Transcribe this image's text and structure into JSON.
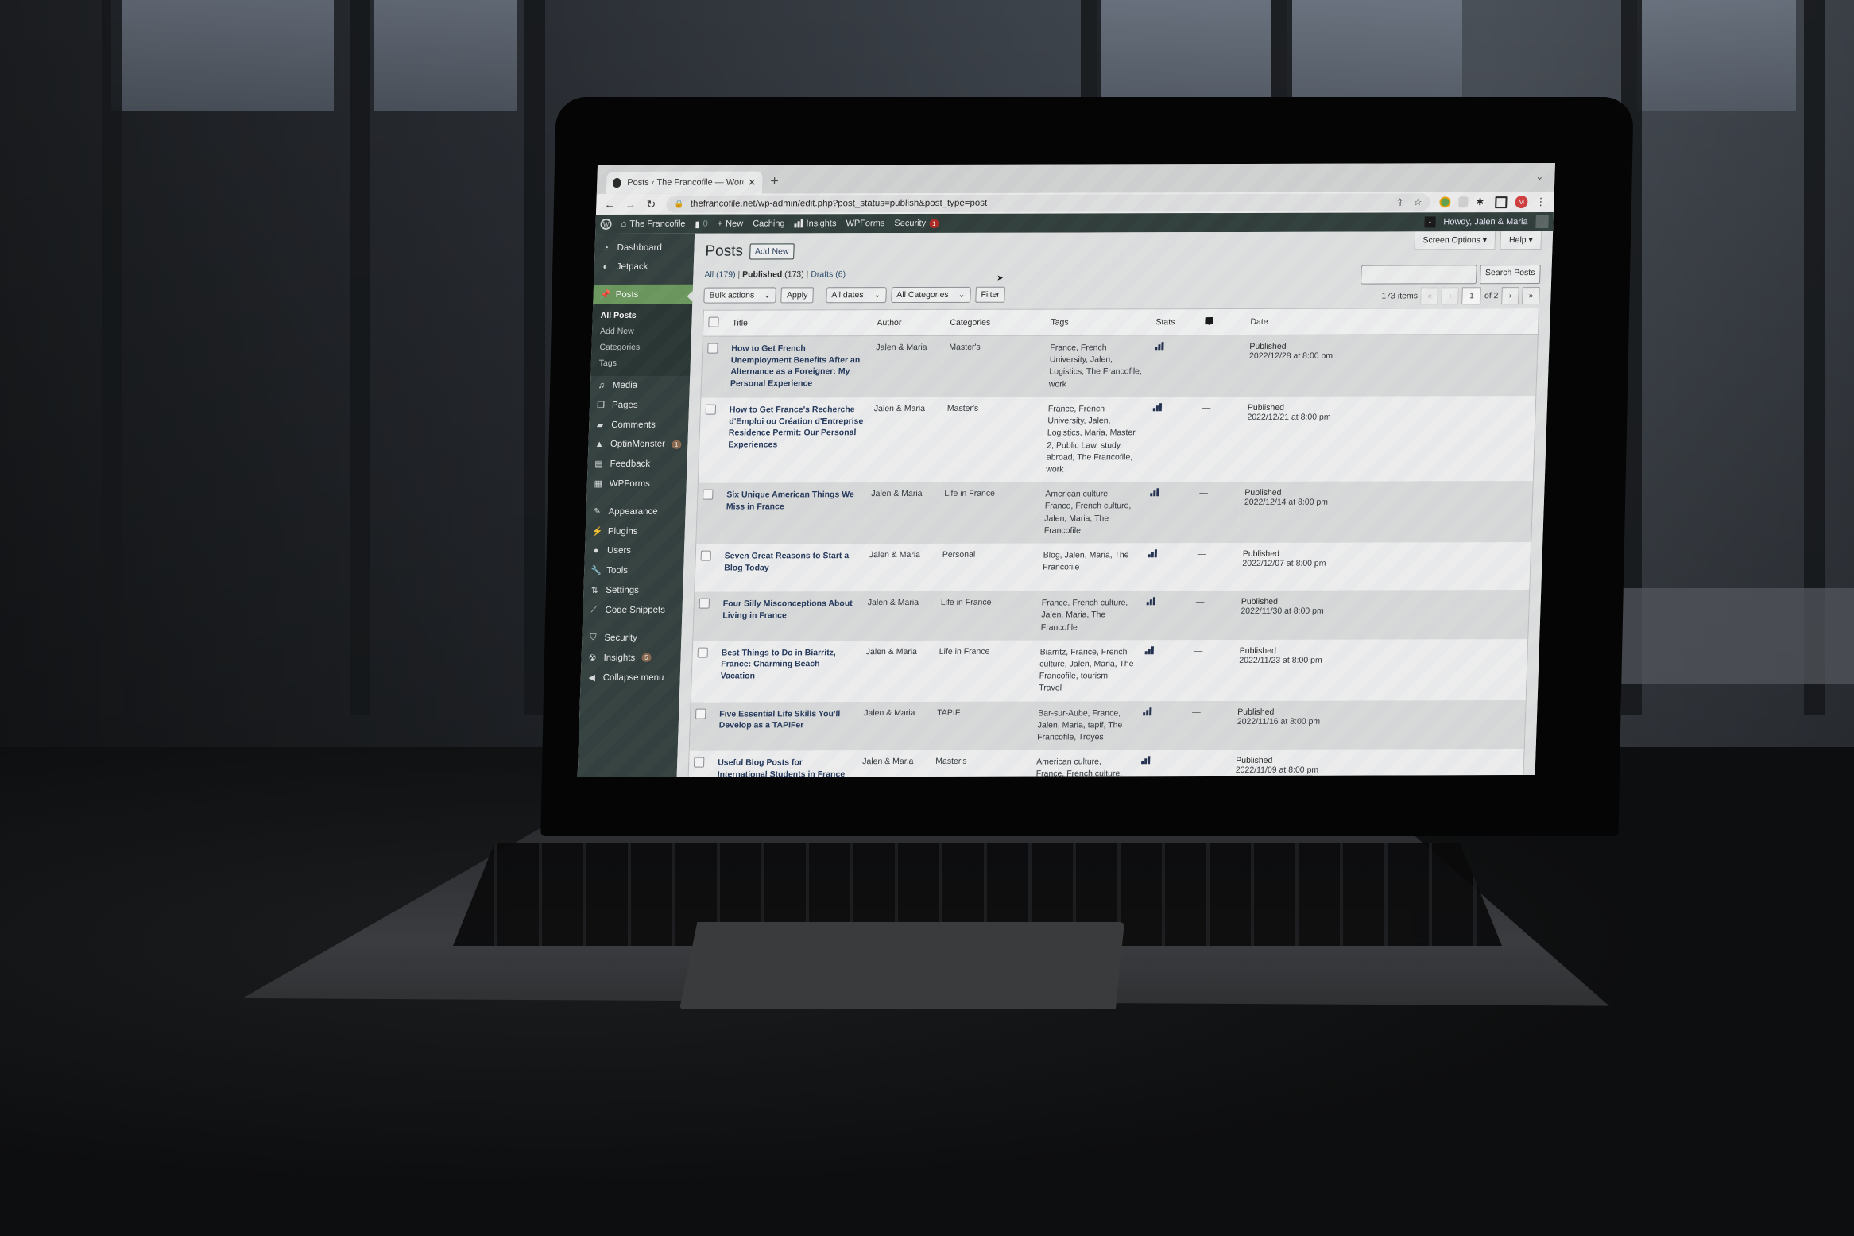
{
  "browser": {
    "tab_title": "Posts ‹ The Francofile — WordPress",
    "url": "thefrancofile.net/wp-admin/edit.php?post_status=publish&post_type=post",
    "profile_initial": "M"
  },
  "admin_bar": {
    "site_name": "The Francofile",
    "comments_count": "0",
    "new_label": "New",
    "caching_label": "Caching",
    "insights_label": "Insights",
    "wpforms_label": "WPForms",
    "security_label": "Security",
    "security_badge": "1",
    "greeting": "Howdy, Jalen & Maria"
  },
  "sidebar": {
    "items": [
      {
        "label": "Dashboard",
        "icon": "dashboard-icon"
      },
      {
        "label": "Jetpack",
        "icon": "jetpack-icon"
      },
      {
        "label": "Posts",
        "icon": "pin-icon",
        "active": true
      },
      {
        "label": "Media",
        "icon": "media-icon"
      },
      {
        "label": "Pages",
        "icon": "pages-icon"
      },
      {
        "label": "Comments",
        "icon": "comment-icon"
      },
      {
        "label": "OptinMonster",
        "icon": "optinmonster-icon",
        "badge": "1"
      },
      {
        "label": "Feedback",
        "icon": "feedback-icon"
      },
      {
        "label": "WPForms",
        "icon": "wpforms-icon"
      },
      {
        "label": "Appearance",
        "icon": "brush-icon"
      },
      {
        "label": "Plugins",
        "icon": "plug-icon"
      },
      {
        "label": "Users",
        "icon": "user-icon"
      },
      {
        "label": "Tools",
        "icon": "wrench-icon"
      },
      {
        "label": "Settings",
        "icon": "settings-icon"
      },
      {
        "label": "Code Snippets",
        "icon": "code-icon"
      },
      {
        "label": "Security",
        "icon": "shield-icon"
      },
      {
        "label": "Insights",
        "icon": "insights-icon",
        "badge": "5"
      },
      {
        "label": "Collapse menu",
        "icon": "collapse-icon"
      }
    ],
    "posts_submenu": [
      "All Posts",
      "Add New",
      "Categories",
      "Tags"
    ]
  },
  "main": {
    "title": "Posts",
    "add_new": "Add New",
    "screen_options": "Screen Options ▾",
    "help": "Help ▾",
    "views": {
      "all": "All",
      "all_count": "(179)",
      "published": "Published",
      "published_count": "(173)",
      "drafts": "Drafts",
      "drafts_count": "(6)"
    },
    "search_placeholder": "",
    "search_button": "Search Posts",
    "bulk_actions": "Bulk actions",
    "apply": "Apply",
    "dates_filter": "All dates",
    "categories_filter": "All Categories",
    "filter": "Filter",
    "items_count": "173 items",
    "pagination": {
      "first": "«",
      "prev": "‹",
      "current": "1",
      "of": "of 2",
      "next": "›",
      "last": "»"
    },
    "columns": [
      "Title",
      "Author",
      "Categories",
      "Tags",
      "Stats",
      "",
      "Date"
    ],
    "rows": [
      {
        "title": "How to Get French Unemployment Benefits After an Alternance as a Foreigner: My Personal Experience",
        "author": "Jalen & Maria",
        "category": "Master's",
        "tags": "France, French University, Jalen, Logistics, The Francofile, work",
        "comments": "—",
        "status": "Published",
        "date": "2022/12/28 at 8:00 pm"
      },
      {
        "title": "How to Get France's Recherche d'Emploi ou Création d'Entreprise Residence Permit: Our Personal Experiences",
        "author": "Jalen & Maria",
        "category": "Master's",
        "tags": "France, French University, Jalen, Logistics, Maria, Master 2, Public Law, study abroad, The Francofile, work",
        "comments": "—",
        "status": "Published",
        "date": "2022/12/21 at 8:00 pm"
      },
      {
        "title": "Six Unique American Things We Miss in France",
        "author": "Jalen & Maria",
        "category": "Life in France",
        "tags": "American culture, France, French culture, Jalen, Maria, The Francofile",
        "comments": "—",
        "status": "Published",
        "date": "2022/12/14 at 8:00 pm"
      },
      {
        "title": "Seven Great Reasons to Start a Blog Today",
        "author": "Jalen & Maria",
        "category": "Personal",
        "tags": "Blog, Jalen, Maria, The Francofile",
        "comments": "—",
        "status": "Published",
        "date": "2022/12/07 at 8:00 pm"
      },
      {
        "title": "Four Silly Misconceptions About Living in France",
        "author": "Jalen & Maria",
        "category": "Life in France",
        "tags": "France, French culture, Jalen, Maria, The Francofile",
        "comments": "—",
        "status": "Published",
        "date": "2022/11/30 at 8:00 pm"
      },
      {
        "title": "Best Things to Do in Biarritz, France: Charming Beach Vacation",
        "author": "Jalen & Maria",
        "category": "Life in France",
        "tags": "Biarritz, France, French culture, Jalen, Maria, The Francofile, tourism, Travel",
        "comments": "—",
        "status": "Published",
        "date": "2022/11/23 at 8:00 pm"
      },
      {
        "title": "Five Essential Life Skills You'll Develop as a TAPIFer",
        "author": "Jalen & Maria",
        "category": "TAPIF",
        "tags": "Bar-sur-Aube, France, Jalen, Maria, tapif, The Francofile, Troyes",
        "comments": "—",
        "status": "Published",
        "date": "2022/11/16 at 8:00 pm"
      },
      {
        "title": "Useful Blog Posts for International Students in France",
        "author": "Jalen & Maria",
        "category": "Master's",
        "tags": "American culture, France, French culture, French",
        "comments": "—",
        "status": "Published",
        "date": "2022/11/09 at 8:00 pm"
      }
    ]
  },
  "colors": {
    "admin_bar": "#2c3b38",
    "sidebar": "#2f3e3b",
    "active_menu": "#6a9a5c",
    "link": "#1d3358",
    "badge_red": "#b3261e"
  }
}
